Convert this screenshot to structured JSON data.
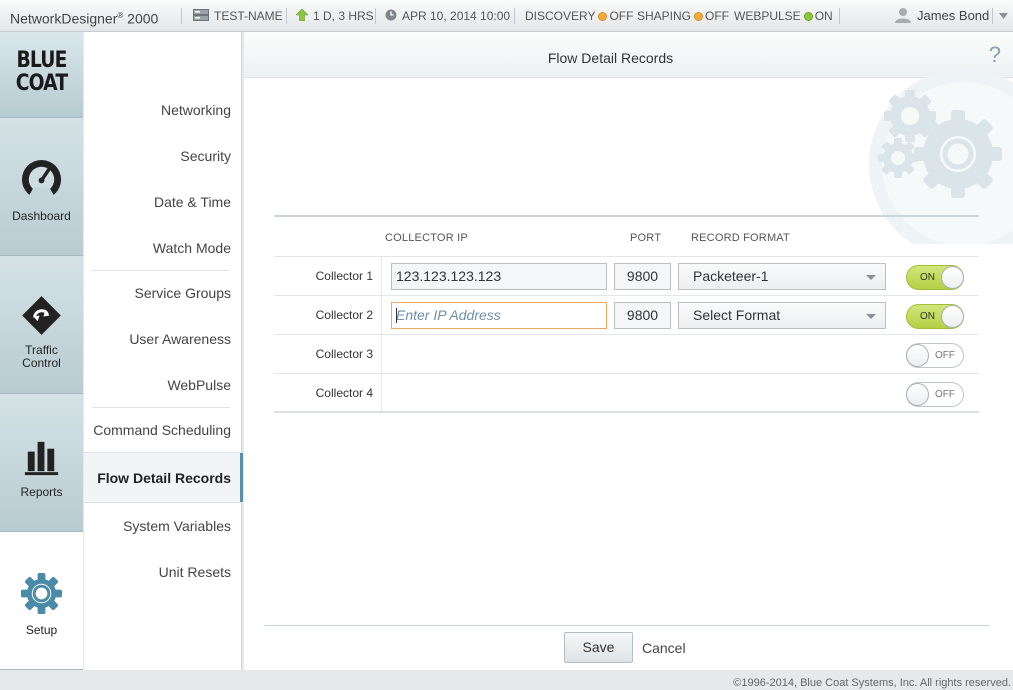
{
  "topbar": {
    "app_name": "NetworkDesigner",
    "app_reg": "®",
    "app_version": "2000",
    "device_name": "TEST-NAME",
    "uptime": "1 D, 3 HRS",
    "datetime": "APR 10, 2014 10:00",
    "discovery_label": "DISCOVERY",
    "discovery_state": "OFF",
    "shaping_label": "SHAPING",
    "shaping_state": "OFF",
    "webpulse_label": "WEBPULSE",
    "webpulse_state": "ON",
    "user_name": "James Bond"
  },
  "logo": {
    "line1": "BLUE",
    "line2": "COAT"
  },
  "rail": {
    "dashboard": "Dashboard",
    "traffic_line1": "Traffic",
    "traffic_line2": "Control",
    "reports": "Reports",
    "setup": "Setup"
  },
  "nav": {
    "items": [
      "Networking",
      "Security",
      "Date & Time",
      "Watch Mode",
      "Service Groups",
      "User Awareness",
      "WebPulse",
      "Command Scheduling",
      "Flow Detail Records",
      "System Variables",
      "Unit Resets"
    ],
    "active": "Flow Detail Records"
  },
  "panel": {
    "title": "Flow Detail Records",
    "help": "?"
  },
  "table": {
    "col_ip": "COLLECTOR IP",
    "col_port": "PORT",
    "col_format": "RECORD FORMAT",
    "rows": [
      {
        "label": "Collector 1",
        "ip": "123.123.123.123",
        "port": "9800",
        "format": "Packeteer-1",
        "toggle": "ON"
      },
      {
        "label": "Collector 2",
        "ip_placeholder": "Enter IP Address",
        "port": "9800",
        "format": "Select Format",
        "toggle": "ON"
      },
      {
        "label": "Collector 3",
        "toggle": "OFF"
      },
      {
        "label": "Collector 4",
        "toggle": "OFF"
      }
    ]
  },
  "actions": {
    "save": "Save",
    "cancel": "Cancel"
  },
  "copyright": "©1996-2014, Blue Coat Systems, Inc. All rights reserved.",
  "colors": {
    "accent": "#5a8fa6",
    "toggle_on": "#b4d045",
    "status_off": "#f2ab3c",
    "status_on": "#8cc63f"
  }
}
